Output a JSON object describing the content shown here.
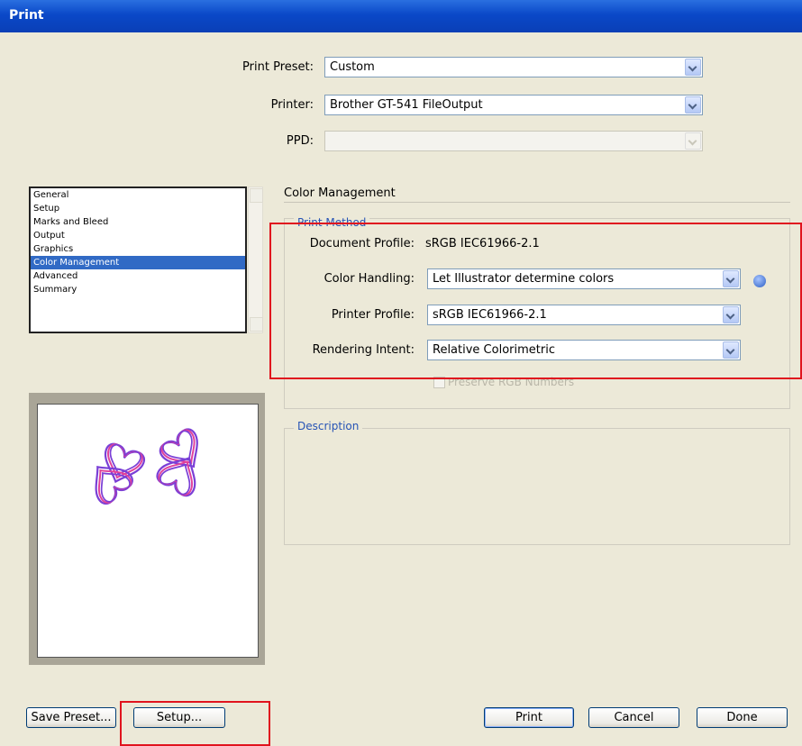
{
  "window": {
    "title": "Print"
  },
  "top": {
    "print_preset_label": "Print Preset:",
    "print_preset_value": "Custom",
    "printer_label": "Printer:",
    "printer_value": "Brother GT-541 FileOutput",
    "ppd_label": "PPD:",
    "ppd_value": ""
  },
  "categories": {
    "items": [
      "General",
      "Setup",
      "Marks and Bleed",
      "Output",
      "Graphics",
      "Color Management",
      "Advanced",
      "Summary"
    ],
    "selected": "Color Management"
  },
  "panel": {
    "section_title": "Color Management",
    "print_method_legend": "Print Method",
    "document_profile_label": "Document Profile:",
    "document_profile_value": "sRGB IEC61966-2.1",
    "color_handling_label": "Color Handling:",
    "color_handling_value": "Let Illustrator determine colors",
    "printer_profile_label": "Printer Profile:",
    "printer_profile_value": "sRGB IEC61966-2.1",
    "rendering_intent_label": "Rendering Intent:",
    "rendering_intent_value": "Relative Colorimetric",
    "preserve_rgb_label": "Preserve RGB Numbers",
    "description_legend": "Description"
  },
  "buttons": {
    "save_preset": "Save Preset...",
    "setup": "Setup...",
    "print": "Print",
    "cancel": "Cancel",
    "done": "Done"
  },
  "icons": {
    "info": "info-icon",
    "dropdown": "chevron-down-icon"
  },
  "colors": {
    "highlight": "#e0141e",
    "selection": "#316ac5",
    "title_bar": "#0a48c8"
  }
}
